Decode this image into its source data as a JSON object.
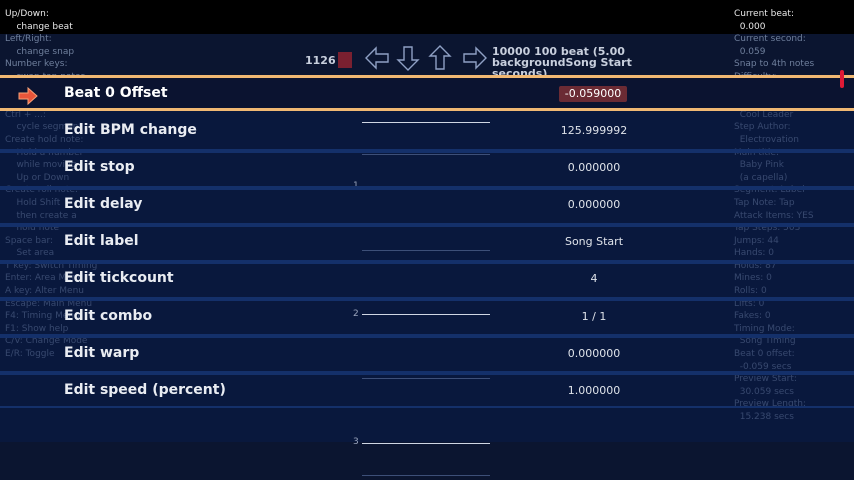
{
  "help_left": [
    {
      "text": "Up/Down:",
      "bright": true
    },
    {
      "text": "    change beat",
      "bright": true
    },
    {
      "text": "Left/Right:",
      "bright": false
    },
    {
      "text": "    change snap",
      "bright": false
    },
    {
      "text": "Number keys:",
      "bright": false
    },
    {
      "text": "",
      "bright": false
    },
    {
      "text": "",
      "bright": false
    },
    {
      "text": "",
      "bright": false
    },
    {
      "text": "    swap tap notes",
      "bright": false
    },
    {
      "text": "Ctrl + shift:",
      "bright": false
    },
    {
      "text": "    swap cycled segment",
      "bright": false
    },
    {
      "text": "Ctrl + ...:",
      "bright": false
    },
    {
      "text": "    cycle segment",
      "bright": false
    },
    {
      "text": "Create hold note:",
      "bright": false
    },
    {
      "text": "    Hold a number",
      "bright": false
    },
    {
      "text": "    while moving",
      "bright": false
    },
    {
      "text": "    Up or Down",
      "bright": false
    },
    {
      "text": "Create roll note:",
      "bright": false
    },
    {
      "text": "    Hold Shift",
      "bright": false
    },
    {
      "text": "    then create a",
      "bright": false
    },
    {
      "text": "    hold note",
      "bright": false
    },
    {
      "text": "Space bar:",
      "bright": false
    },
    {
      "text": "    Set area",
      "bright": false
    },
    {
      "text": "T key: Switch Timing",
      "bright": false
    },
    {
      "text": "Enter: Area Menu",
      "bright": false
    },
    {
      "text": "A key: Alter Menu",
      "bright": false
    },
    {
      "text": "Escape: Main Menu",
      "bright": false
    },
    {
      "text": "F4: Timing Menu",
      "bright": false
    },
    {
      "text": "F1: Show help",
      "bright": false
    },
    {
      "text": "C/V: Change Mode",
      "bright": false
    },
    {
      "text": "E/R: Toggle",
      "bright": false
    }
  ],
  "help_right": [
    {
      "text": "Current beat:",
      "bright": true
    },
    {
      "text": "  0.000",
      "bright": true
    },
    {
      "text": "Current second:",
      "bright": false
    },
    {
      "text": "  0.059",
      "bright": false
    },
    {
      "text": "Snap to 4th notes",
      "bright": false
    },
    {
      "text": "Difficulty:",
      "bright": false
    },
    {
      "text": "  Challenge",
      "bright": false
    },
    {
      "text": "Chart Style:",
      "bright": false
    },
    {
      "text": "  Cool Leader",
      "bright": false
    },
    {
      "text": "Step Author:",
      "bright": false
    },
    {
      "text": "  Electrovation",
      "bright": false
    },
    {
      "text": "Main title:",
      "bright": false
    },
    {
      "text": "  Baby Pink",
      "bright": false
    },
    {
      "text": "  (a capella)",
      "bright": false
    },
    {
      "text": "Segment: Label",
      "bright": false
    },
    {
      "text": "Tap Note: Tap",
      "bright": false
    },
    {
      "text": "Attack Items: YES",
      "bright": false
    },
    {
      "text": "Tap Steps: 503",
      "bright": false
    },
    {
      "text": "Jumps: 44",
      "bright": false
    },
    {
      "text": "Hands: 0",
      "bright": false
    },
    {
      "text": "Holds: 87",
      "bright": false
    },
    {
      "text": "Mines: 0",
      "bright": false
    },
    {
      "text": "Rolls: 0",
      "bright": false
    },
    {
      "text": "Lifts: 0",
      "bright": false
    },
    {
      "text": "Fakes: 0",
      "bright": false
    },
    {
      "text": "Timing Mode:",
      "bright": false
    },
    {
      "text": "  Song Timing",
      "bright": false
    },
    {
      "text": "Beat 0 offset:",
      "bright": false
    },
    {
      "text": "  -0.059 secs",
      "bright": false
    },
    {
      "text": "Preview Start:",
      "bright": false
    },
    {
      "text": "  30.059 secs",
      "bright": false
    },
    {
      "text": "Preview Length:",
      "bright": false
    },
    {
      "text": "  15.238 secs",
      "bright": false
    }
  ],
  "field": {
    "measure_number": "1126",
    "info_line1": "10000 100 beat (5.00",
    "info_line2": "backgroundSong Start",
    "info_line3": "seconds)",
    "beat_labels": [
      "1",
      "2",
      "3"
    ]
  },
  "menu": {
    "rows": [
      {
        "label": "Beat 0 Offset",
        "value": "-0.059000",
        "selected": true
      },
      {
        "label": "Edit BPM change",
        "value": "125.999992",
        "selected": false
      },
      {
        "label": "Edit stop",
        "value": "0.000000",
        "selected": false
      },
      {
        "label": "Edit delay",
        "value": "0.000000",
        "selected": false
      },
      {
        "label": "Edit label",
        "value": "Song Start",
        "selected": false
      },
      {
        "label": "Edit tickcount",
        "value": "4",
        "selected": false
      },
      {
        "label": "Edit combo",
        "value": "1 / 1",
        "selected": false
      },
      {
        "label": "Edit warp",
        "value": "0.000000",
        "selected": false
      },
      {
        "label": "Edit speed (percent)",
        "value": "1.000000",
        "selected": false
      }
    ]
  },
  "colors": {
    "accent": "#f0b873",
    "value_highlight": "#6b2b34",
    "cursor": "#e8553a",
    "scroll": "#e01a36"
  },
  "icons": {
    "cursor": "right-arrow-icon",
    "receptors": [
      "left-arrow-icon",
      "down-arrow-icon",
      "up-arrow-icon",
      "right-arrow-icon"
    ]
  }
}
